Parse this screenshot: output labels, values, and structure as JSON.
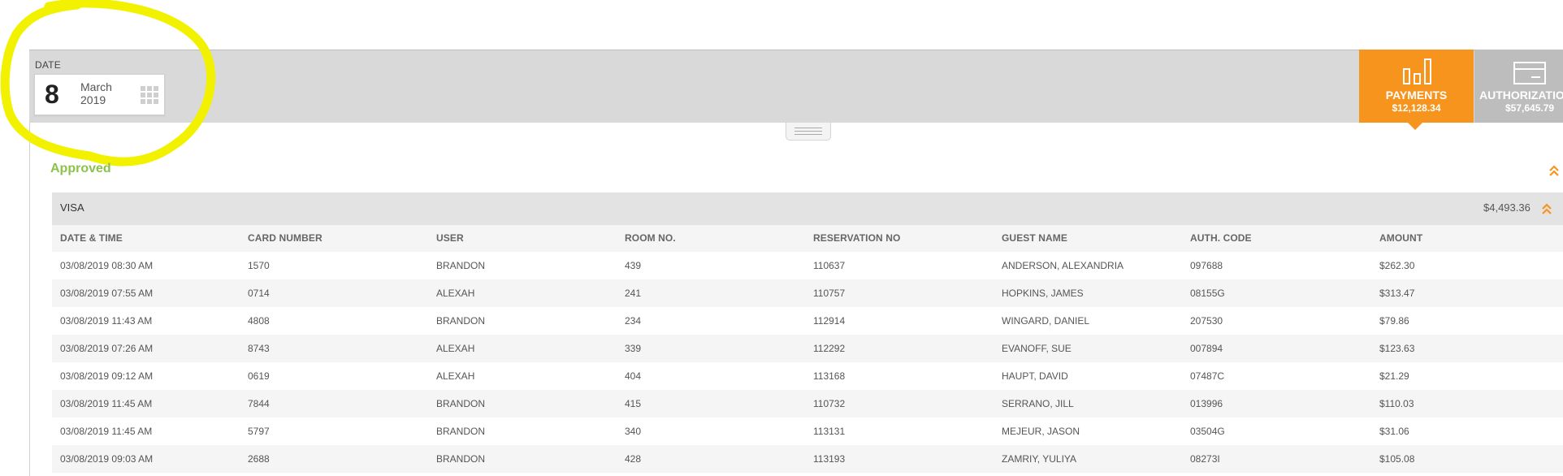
{
  "date_picker": {
    "label": "DATE",
    "day": "8",
    "month": "March",
    "year": "2019"
  },
  "tabs": [
    {
      "name": "PAYMENTS",
      "amount": "$12,128.34",
      "icon": "bar-chart-icon",
      "active": true
    },
    {
      "name": "AUTHORIZATIO",
      "amount": "$57,645.79",
      "icon": "credit-card-icon",
      "active": false
    }
  ],
  "section": {
    "title": "Approved"
  },
  "group": {
    "label": "VISA",
    "total": "$4,493.36"
  },
  "table": {
    "columns": [
      "DATE & TIME",
      "CARD NUMBER",
      "USER",
      "ROOM NO.",
      "RESERVATION NO",
      "GUEST NAME",
      "AUTH. CODE",
      "AMOUNT"
    ],
    "rows": [
      [
        "03/08/2019 08:30 AM",
        "1570",
        "BRANDON",
        "439",
        "110637",
        "ANDERSON, ALEXANDRIA",
        "097688",
        "$262.30"
      ],
      [
        "03/08/2019 07:55 AM",
        "0714",
        "ALEXAH",
        "241",
        "110757",
        "HOPKINS, JAMES",
        "08155G",
        "$313.47"
      ],
      [
        "03/08/2019 11:43 AM",
        "4808",
        "BRANDON",
        "234",
        "112914",
        "WINGARD, DANIEL",
        "207530",
        "$79.86"
      ],
      [
        "03/08/2019 07:26 AM",
        "8743",
        "ALEXAH",
        "339",
        "112292",
        "EVANOFF, SUE",
        "007894",
        "$123.63"
      ],
      [
        "03/08/2019 09:12 AM",
        "0619",
        "ALEXAH",
        "404",
        "113168",
        "HAUPT, DAVID",
        "07487C",
        "$21.29"
      ],
      [
        "03/08/2019 11:45 AM",
        "7844",
        "BRANDON",
        "415",
        "110732",
        "SERRANO, JILL",
        "013996",
        "$110.03"
      ],
      [
        "03/08/2019 11:45 AM",
        "5797",
        "BRANDON",
        "340",
        "113131",
        "MEJEUR, JASON",
        "03504G",
        "$31.06"
      ],
      [
        "03/08/2019 09:03 AM",
        "2688",
        "BRANDON",
        "428",
        "113193",
        "ZAMRIY, YULIYA",
        "08273I",
        "$105.08"
      ]
    ]
  },
  "colors": {
    "accent": "#f7941d",
    "approved": "#8bc34a",
    "highlight": "#f5f500",
    "inactive_tab": "#bdbdbd"
  }
}
